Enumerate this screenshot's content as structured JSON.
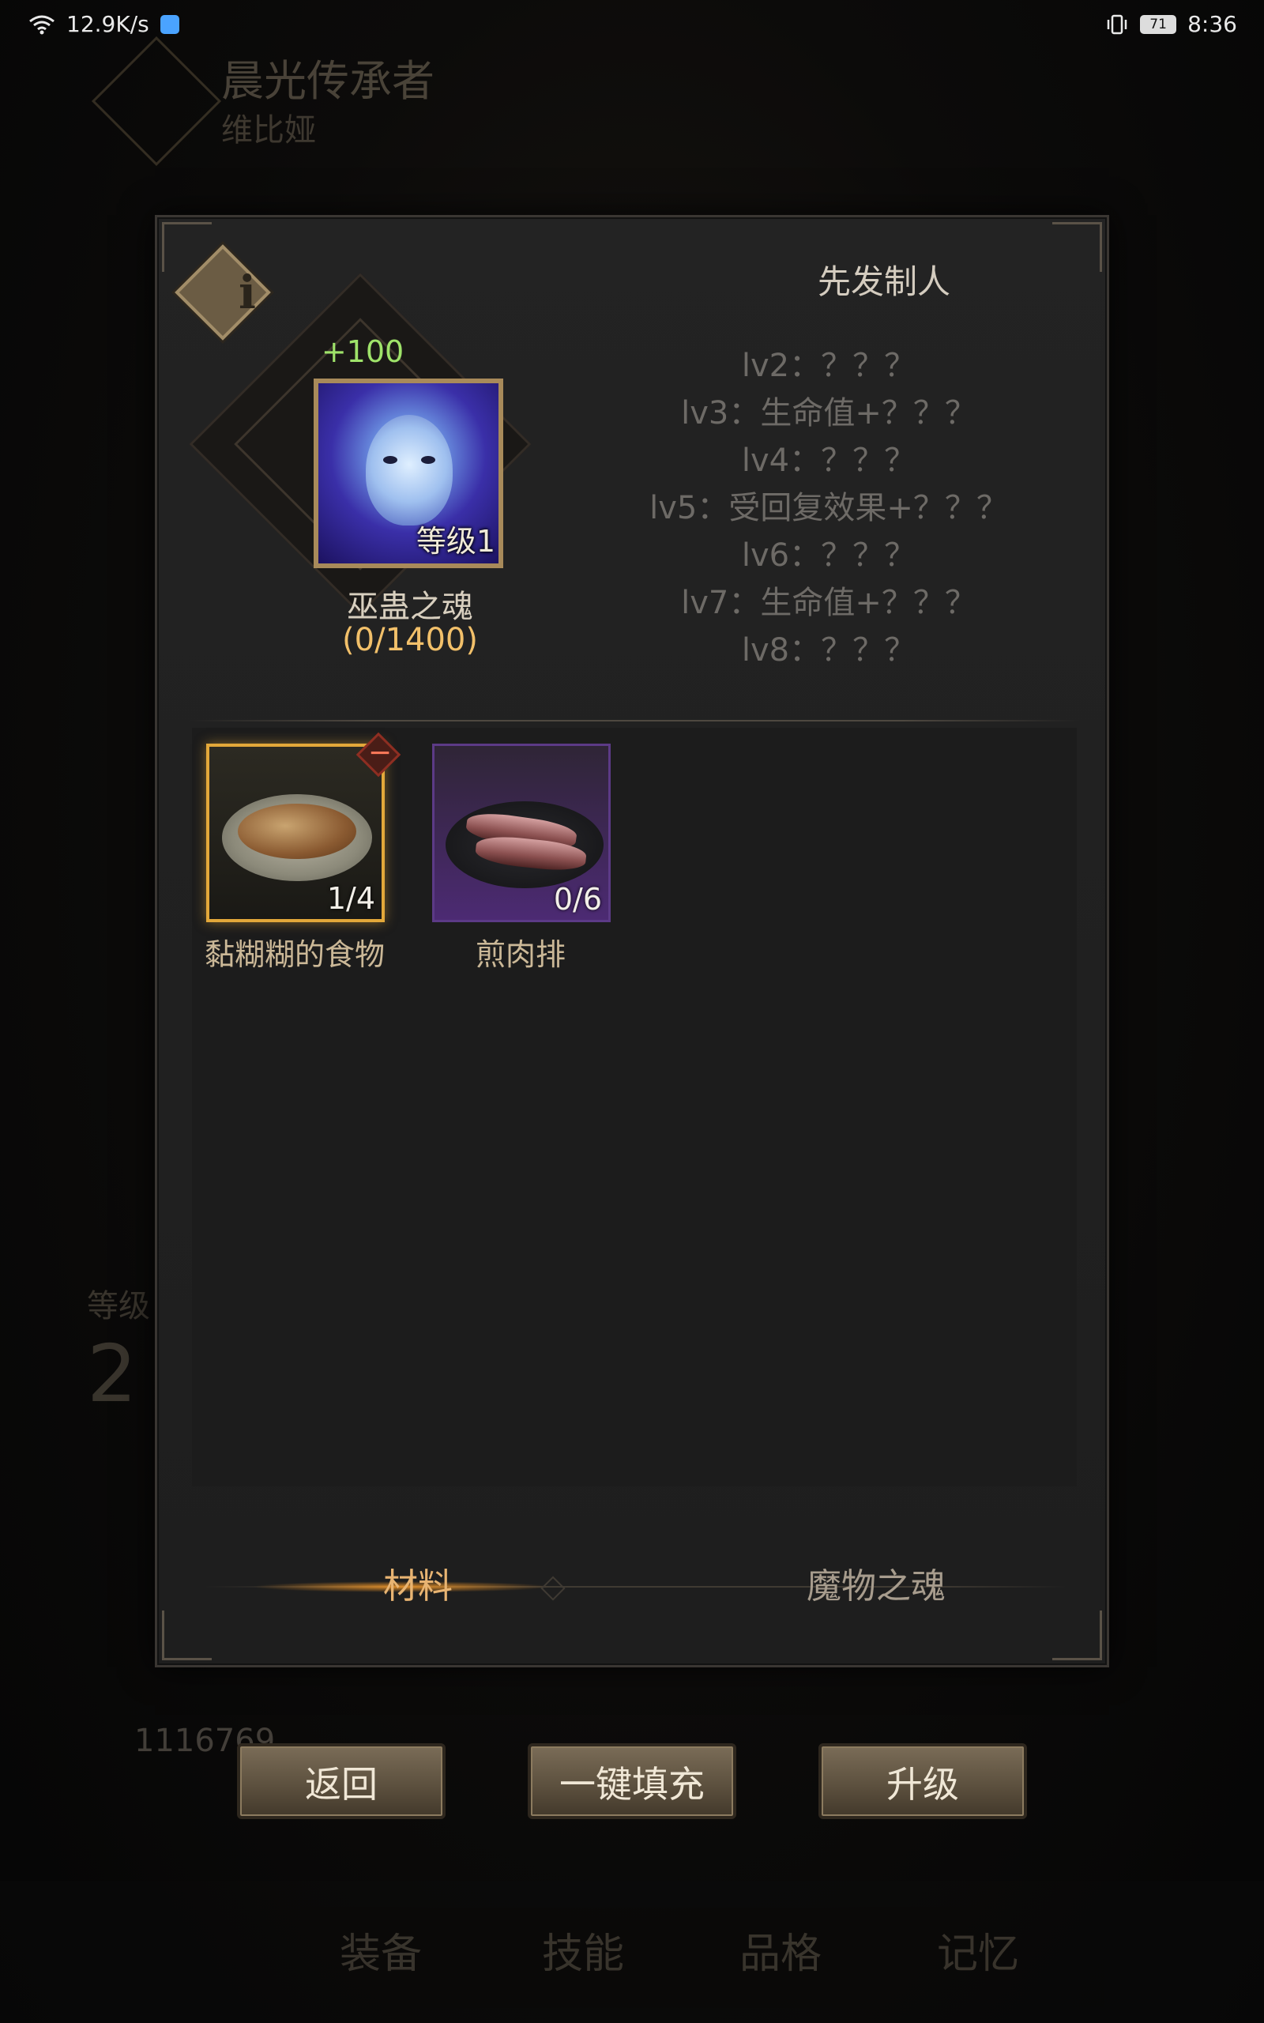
{
  "status_bar": {
    "network_speed": "12.9K/s",
    "battery": "71",
    "time": "8:36"
  },
  "background": {
    "character_title": "晨光传承者",
    "character_name": "维比娅",
    "level_label": "等级",
    "level_value": "2",
    "gold": "1116769",
    "nav_tabs": [
      "装备",
      "技能",
      "品格",
      "记忆"
    ]
  },
  "dialog": {
    "info_button": "i",
    "soul": {
      "bonus": "+100",
      "level_tag": "等级1",
      "name": "巫蛊之魂",
      "progress": "(0/1400)"
    },
    "title": "先发制人",
    "levels": [
      "lv2：？？？",
      "lv3：生命值+？？？",
      "lv4：？？？",
      "lv5：受回复效果+？？？",
      "lv6：？？？",
      "lv7：生命值+？？？",
      "lv8：？？？"
    ],
    "materials": [
      {
        "name": "黏糊糊的食物",
        "count": "1/4",
        "selected": true
      },
      {
        "name": "煎肉排",
        "count": "0/6",
        "selected": false
      }
    ],
    "remove_button": "−",
    "tabs": {
      "materials": "材料",
      "monster_souls": "魔物之魂"
    }
  },
  "buttons": {
    "back": "返回",
    "auto_fill": "一键填充",
    "upgrade": "升级"
  },
  "colors": {
    "accent_gold": "#e3a83a",
    "bonus_green": "#9fe36a",
    "progress_orange": "#f2c06a"
  }
}
